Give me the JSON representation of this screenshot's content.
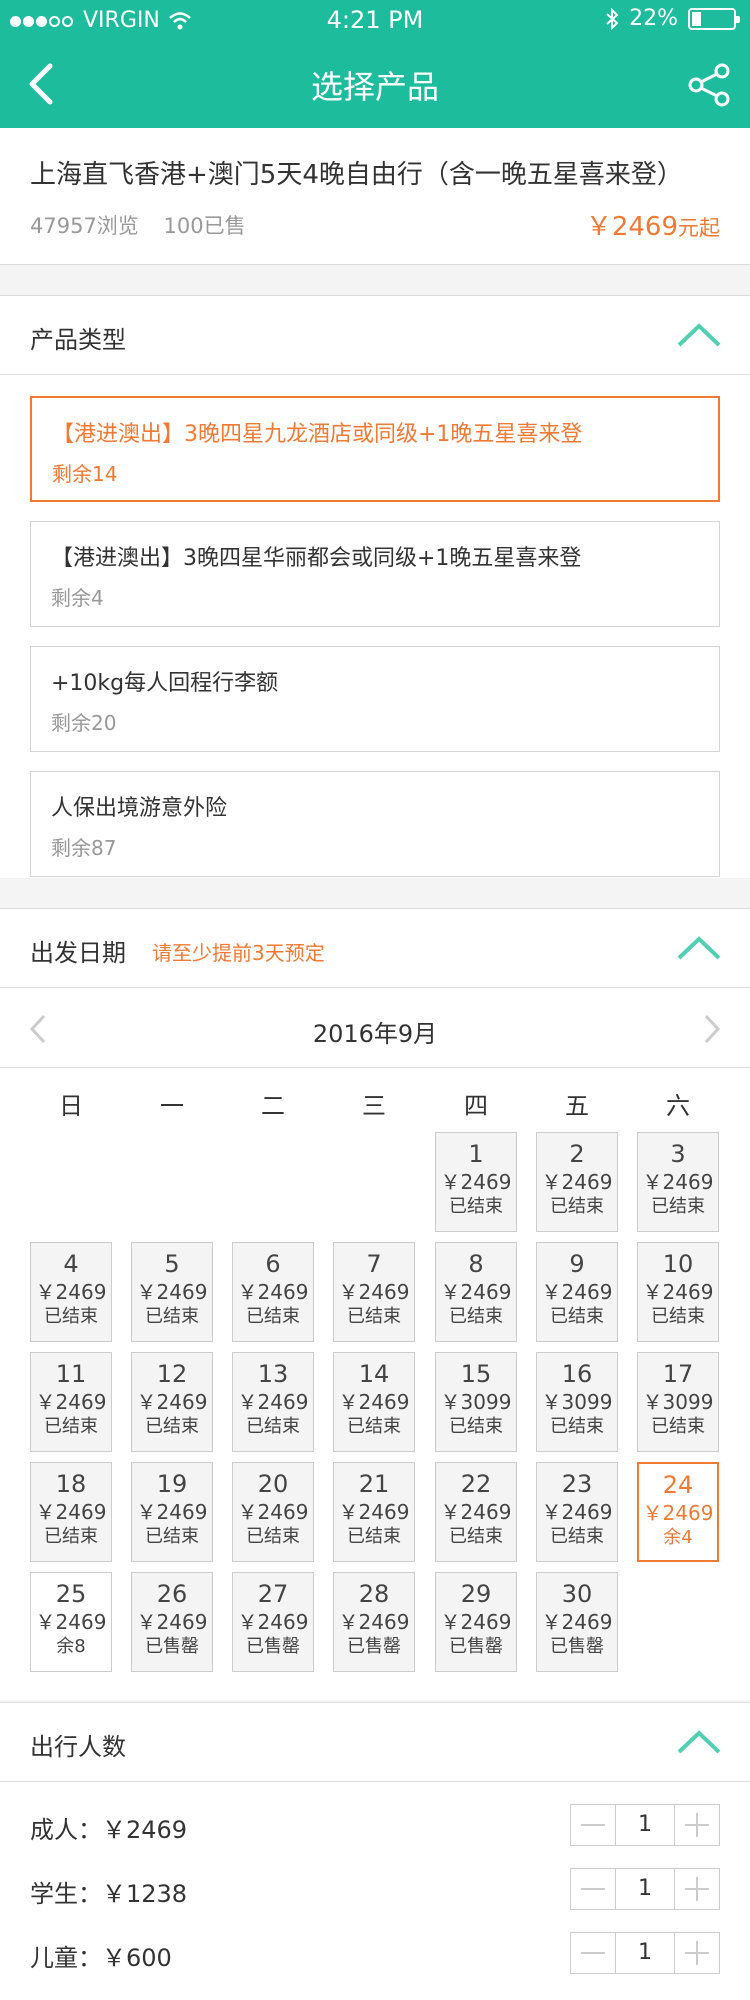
{
  "status": {
    "carrier": "VIRGIN",
    "time": "4:21 PM",
    "battery": "22%"
  },
  "header": {
    "title": "选择产品"
  },
  "product": {
    "name": "上海直飞香港+澳门5天4晚自由行（含一晚五星喜来登）",
    "views": "47957浏览",
    "sold": "100已售",
    "price": "￥2469",
    "price_unit": "元起"
  },
  "types": {
    "label": "产品类型",
    "options": [
      {
        "title": "【港进澳出】3晚四星九龙酒店或同级+1晚五星喜来登",
        "remain": "剩余14",
        "selected": true
      },
      {
        "title": "【港进澳出】3晚四星华丽都会或同级+1晚五星喜来登",
        "remain": "剩余4"
      },
      {
        "title": "+10kg每人回程行李额",
        "remain": "剩余20"
      },
      {
        "title": "人保出境游意外险",
        "remain": "剩余87"
      }
    ]
  },
  "date": {
    "label": "出发日期",
    "hint": "请至少提前3天预定",
    "month": "2016年9月",
    "weekdays": [
      "日",
      "一",
      "二",
      "三",
      "四",
      "五",
      "六"
    ],
    "days": [
      {
        "d": "1",
        "p": "￥2469",
        "s": "已结束"
      },
      {
        "d": "2",
        "p": "￥2469",
        "s": "已结束"
      },
      {
        "d": "3",
        "p": "￥2469",
        "s": "已结束"
      },
      {
        "d": "4",
        "p": "￥2469",
        "s": "已结束"
      },
      {
        "d": "5",
        "p": "￥2469",
        "s": "已结束"
      },
      {
        "d": "6",
        "p": "￥2469",
        "s": "已结束"
      },
      {
        "d": "7",
        "p": "￥2469",
        "s": "已结束"
      },
      {
        "d": "8",
        "p": "￥2469",
        "s": "已结束"
      },
      {
        "d": "9",
        "p": "￥2469",
        "s": "已结束"
      },
      {
        "d": "10",
        "p": "￥2469",
        "s": "已结束"
      },
      {
        "d": "11",
        "p": "￥2469",
        "s": "已结束"
      },
      {
        "d": "12",
        "p": "￥2469",
        "s": "已结束"
      },
      {
        "d": "13",
        "p": "￥2469",
        "s": "已结束"
      },
      {
        "d": "14",
        "p": "￥2469",
        "s": "已结束"
      },
      {
        "d": "15",
        "p": "￥3099",
        "s": "已结束"
      },
      {
        "d": "16",
        "p": "￥3099",
        "s": "已结束"
      },
      {
        "d": "17",
        "p": "￥3099",
        "s": "已结束"
      },
      {
        "d": "18",
        "p": "￥2469",
        "s": "已结束"
      },
      {
        "d": "19",
        "p": "￥2469",
        "s": "已结束"
      },
      {
        "d": "20",
        "p": "￥2469",
        "s": "已结束"
      },
      {
        "d": "21",
        "p": "￥2469",
        "s": "已结束"
      },
      {
        "d": "22",
        "p": "￥2469",
        "s": "已结束"
      },
      {
        "d": "23",
        "p": "￥2469",
        "s": "已结束"
      },
      {
        "d": "24",
        "p": "￥2469",
        "s": "余4",
        "selected": true
      },
      {
        "d": "25",
        "p": "￥2469",
        "s": "余8",
        "available": true
      },
      {
        "d": "26",
        "p": "￥2469",
        "s": "已售罄"
      },
      {
        "d": "27",
        "p": "￥2469",
        "s": "已售罄"
      },
      {
        "d": "28",
        "p": "￥2469",
        "s": "已售罄"
      },
      {
        "d": "29",
        "p": "￥2469",
        "s": "已售罄"
      },
      {
        "d": "30",
        "p": "￥2469",
        "s": "已售罄"
      }
    ]
  },
  "travellers": {
    "label": "出行人数",
    "rows": [
      {
        "label": "成人：￥2469",
        "count": "1"
      },
      {
        "label": "学生：￥1238",
        "count": "1"
      },
      {
        "label": "儿童：￥600",
        "count": "1"
      }
    ]
  },
  "colors": {
    "accent": "#1dbc9c",
    "highlight": "#f07a34"
  }
}
